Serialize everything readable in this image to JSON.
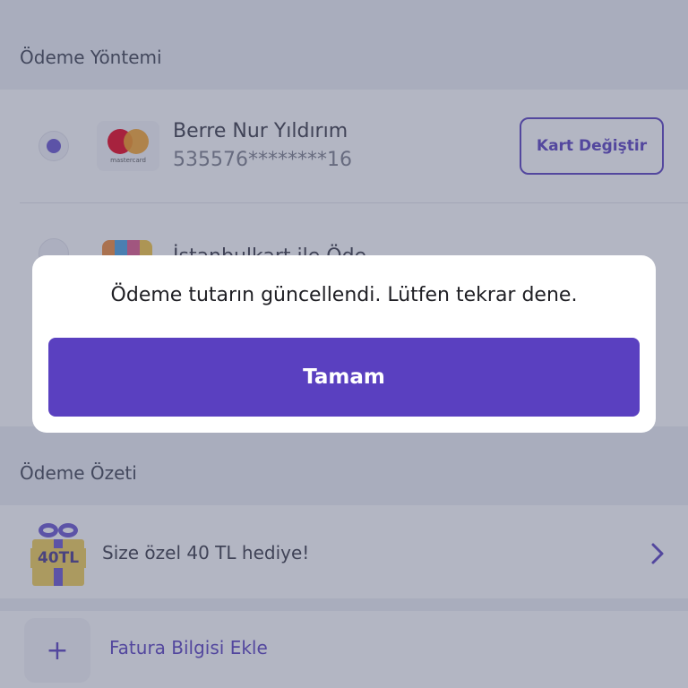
{
  "payment_method": {
    "section_title": "Ödeme Yöntemi",
    "saved_card": {
      "holder_name": "Berre Nur Yıldırım",
      "masked_number": "535576********16",
      "brand_text": "mastercard",
      "change_button_label": "Kart Değiştir"
    },
    "alt_option": {
      "label": "İstanbulkart ile Öde"
    }
  },
  "summary": {
    "section_title": "Ödeme Özeti",
    "gift": {
      "badge_text": "40TL",
      "label": "Size özel 40 TL hediye!"
    },
    "invoice": {
      "plus_symbol": "+",
      "label": "Fatura Bilgisi Ekle"
    }
  },
  "dialog": {
    "message": "Ödeme tutarın güncellendi. Lütfen tekrar dene.",
    "confirm_label": "Tamam"
  },
  "colors": {
    "accent": "#5a40c0",
    "overlay": "rgba(74,82,112,0.42)"
  },
  "icons": [
    "mastercard-logo",
    "istanbulkart-logo",
    "gift-icon",
    "chevron-right-icon",
    "plus-icon"
  ]
}
